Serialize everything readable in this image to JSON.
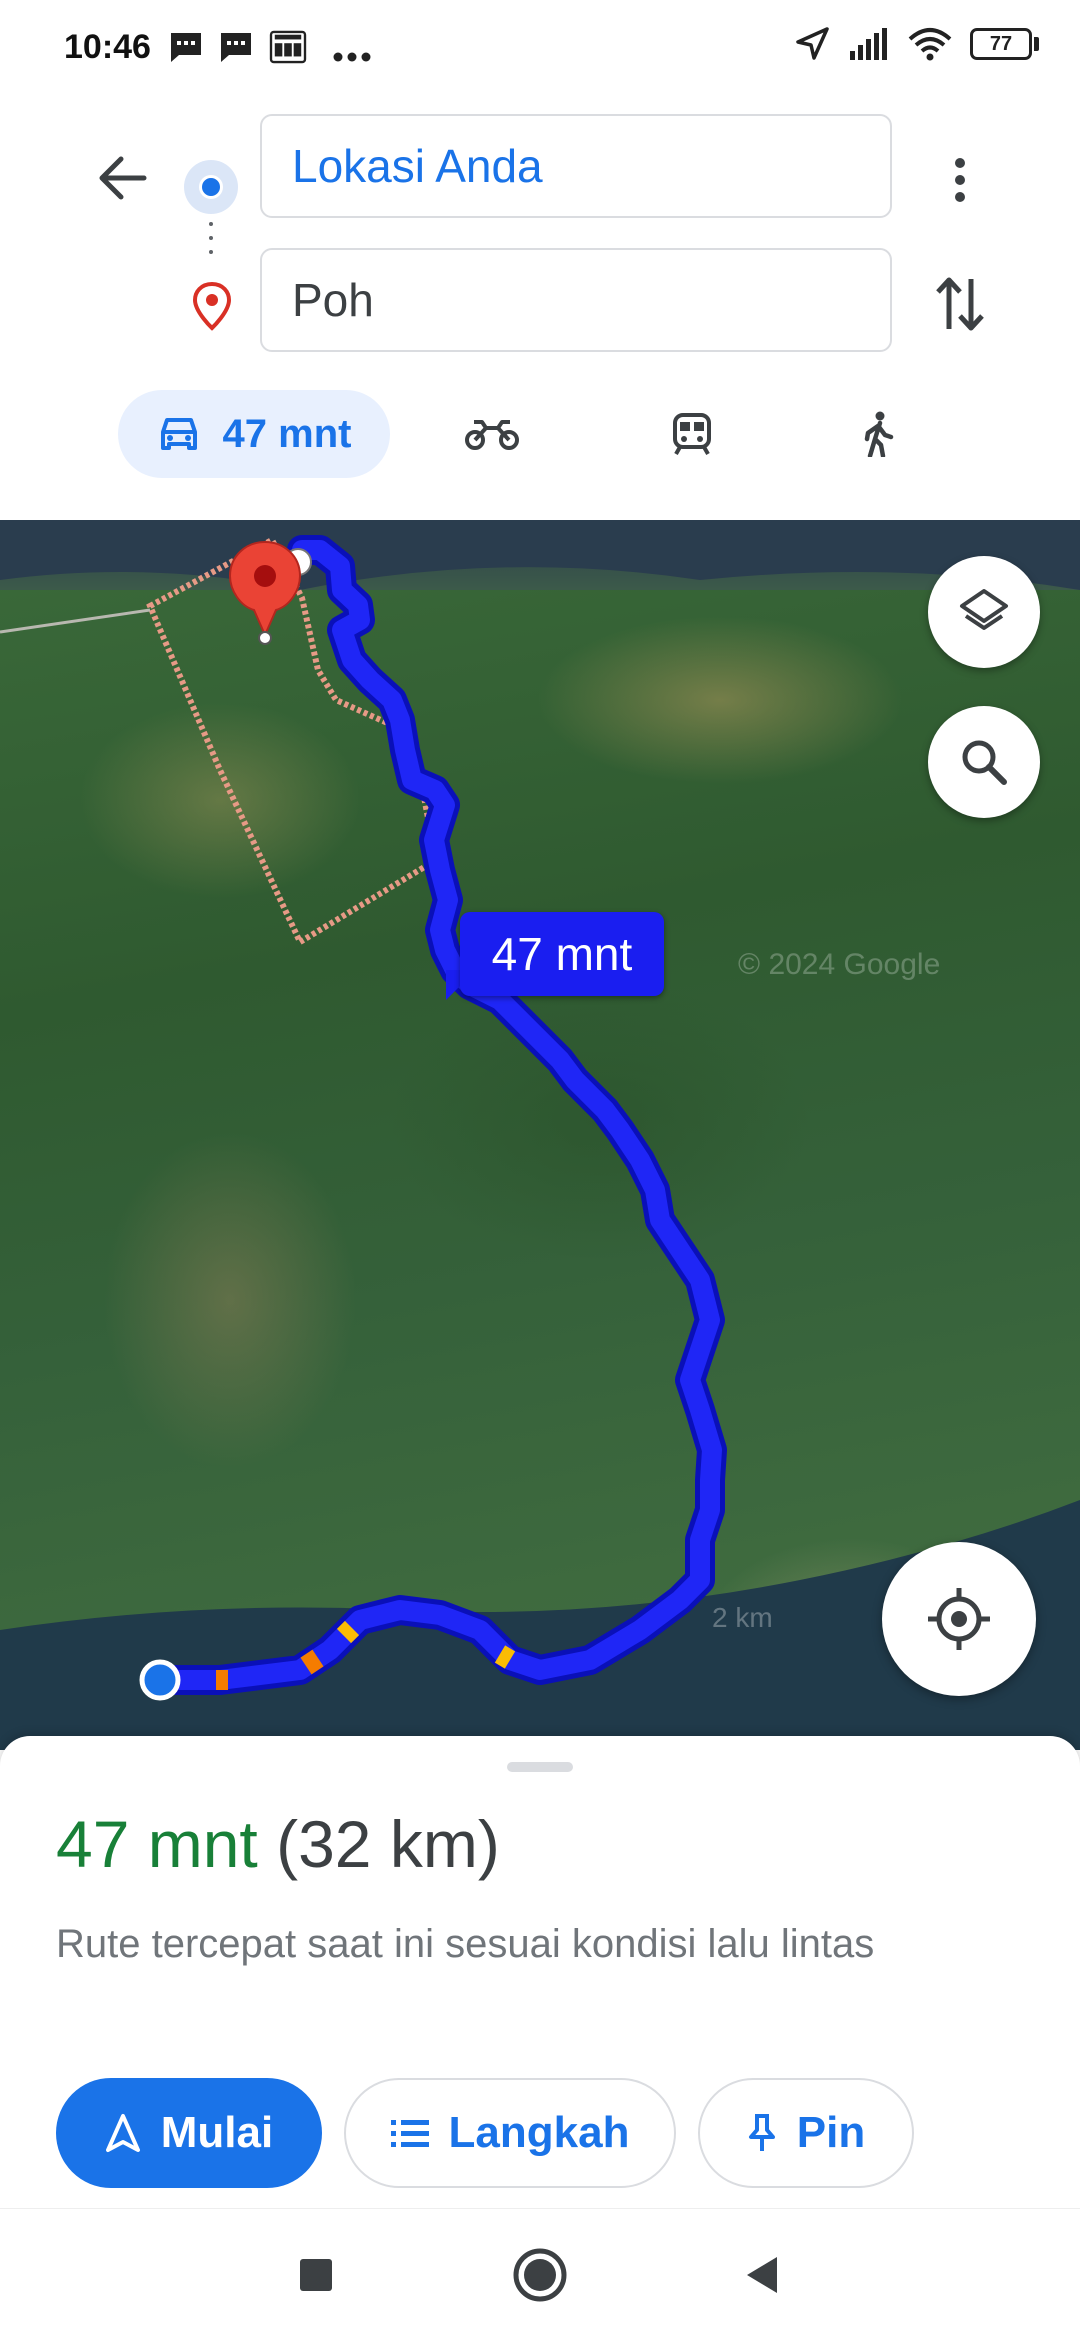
{
  "status_bar": {
    "time": "10:46",
    "notification_icons": [
      "message-icon",
      "message-icon",
      "lottery-app-icon",
      "more-notifications-icon"
    ],
    "battery": "77",
    "icons": [
      "location-arrow-icon",
      "signal-icon",
      "wifi-icon",
      "battery-icon"
    ]
  },
  "header": {
    "origin": "Lokasi Anda",
    "destination": "Poh"
  },
  "travel_modes": [
    {
      "mode": "car",
      "label": "47 mnt",
      "active": true
    },
    {
      "mode": "motorcycle",
      "label": "",
      "active": false
    },
    {
      "mode": "transit",
      "label": "",
      "active": false
    },
    {
      "mode": "walk",
      "label": "",
      "active": false
    }
  ],
  "map": {
    "eta_bubble": "47 mnt",
    "watermark": "© 2024 Google",
    "scale": "2 km",
    "route_color": "#1a1ef0"
  },
  "sheet": {
    "duration": "47 mnt",
    "distance": "(32 km)",
    "description": "Rute tercepat saat ini sesuai kondisi lalu lintas",
    "start_label": "Mulai",
    "steps_label": "Langkah",
    "pin_label": "Pin"
  },
  "colors": {
    "accent": "#1a73e8",
    "duration_green": "#188038"
  }
}
